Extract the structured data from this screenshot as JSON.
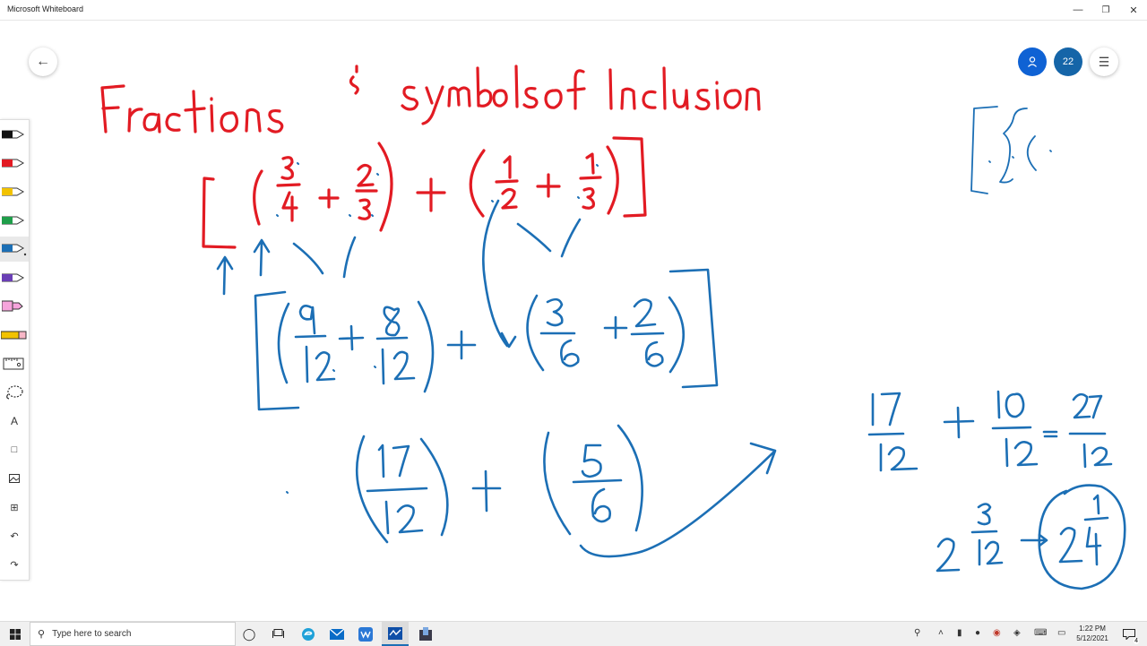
{
  "window": {
    "title": "Microsoft Whiteboard",
    "minimize_icon": "minimize-icon",
    "restore_icon": "restore-icon",
    "close_icon": "close-icon"
  },
  "top_controls": {
    "participants_count": "22",
    "accent": "#0f62d4",
    "badge_color": "#1565a8"
  },
  "board": {
    "ink_red": "#e21b23",
    "ink_blue": "#1c6fb5",
    "title": "Fractions & symbols of Inclusion",
    "expression_1": "[ ( 3/4 + 2/3 ) + ( 1/2 + 1/3 ) ]",
    "expression_2": "[ ( 9/12 + 8/12 ) + ( 3/6 + 2/6 ) ]",
    "expression_3": "( 17/12 ) + ( 5/6 )",
    "sum": "17/12 + 10/12 = 27/12",
    "result": "2 3/12 → 2 1/4",
    "symbols": "[ { ("
  },
  "taskbar": {
    "search_placeholder": "Type here to search",
    "time": "1:22 PM",
    "date": "5/12/2021",
    "notifications": "4"
  }
}
